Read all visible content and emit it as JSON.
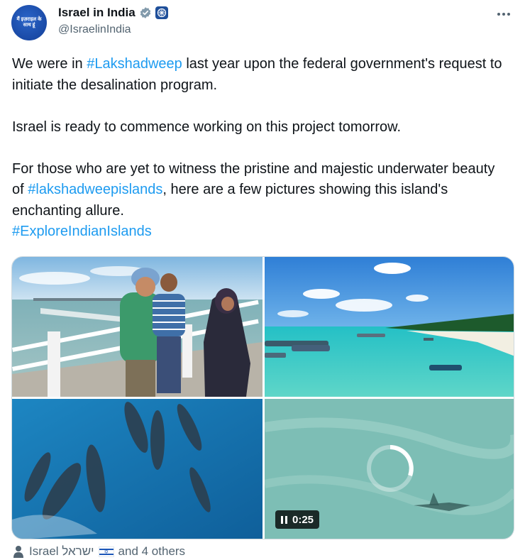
{
  "author": {
    "display_name": "Israel in India",
    "handle": "@IsraelinIndia",
    "avatar_text": "मैं इज़राइल के साथ हूं"
  },
  "tweet": {
    "line1_pre": "We were in ",
    "hashtag1": "#Lakshadweep",
    "line1_post": " last year upon the federal government's request to initiate the desalination program.",
    "para2": "Israel is ready to commence working on this project tomorrow.",
    "para3_pre": "For those who are yet to witness the pristine and majestic underwater beauty of ",
    "hashtag2": "#lakshadweepislands",
    "para3_post": ", here are a few pictures showing this island's enchanting allure.",
    "hashtag3": "#ExploreIndianIslands"
  },
  "media": {
    "video_time": "0:25"
  },
  "footer": {
    "tagged_pre": "Israel ישראל",
    "tagged_post": "and 4 others"
  },
  "colors": {
    "accent": "#1d9bf0",
    "text": "#0f1419",
    "muted": "#536471"
  }
}
